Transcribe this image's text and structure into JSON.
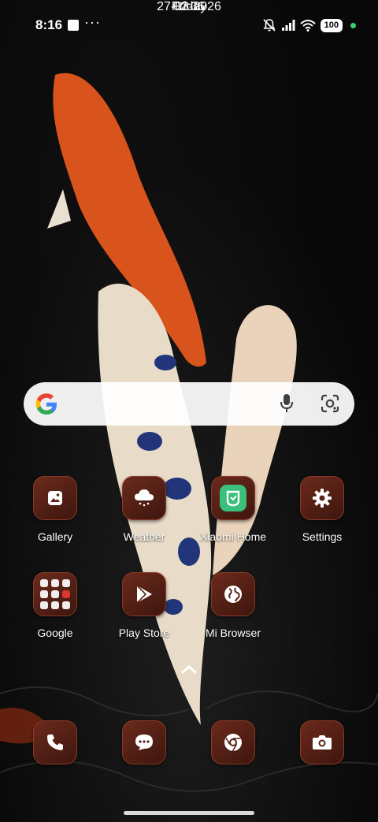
{
  "status_bar": {
    "time": "8:16",
    "battery": "100"
  },
  "clock": {
    "time": "02:36",
    "date": "27-03-2026",
    "day": "Friday"
  },
  "apps_row1": [
    {
      "label": "Gallery",
      "icon": "gallery-icon"
    },
    {
      "label": "Weather",
      "icon": "weather-icon"
    },
    {
      "label": "Xiaomi Home",
      "icon": "xiaomi-home-icon"
    },
    {
      "label": "Settings",
      "icon": "gear-icon"
    }
  ],
  "apps_row2": [
    {
      "label": "Google",
      "icon": "google-folder-icon"
    },
    {
      "label": "Play Store",
      "icon": "play-store-icon"
    },
    {
      "label": "Mi Browser",
      "icon": "globe-icon"
    }
  ],
  "dock": [
    {
      "icon": "phone-icon"
    },
    {
      "icon": "messages-icon"
    },
    {
      "icon": "chrome-icon"
    },
    {
      "icon": "camera-icon"
    }
  ],
  "colors": {
    "tile": "#4f1d12",
    "tile_border": "#8a3a26",
    "accent_green": "#35d36b"
  }
}
